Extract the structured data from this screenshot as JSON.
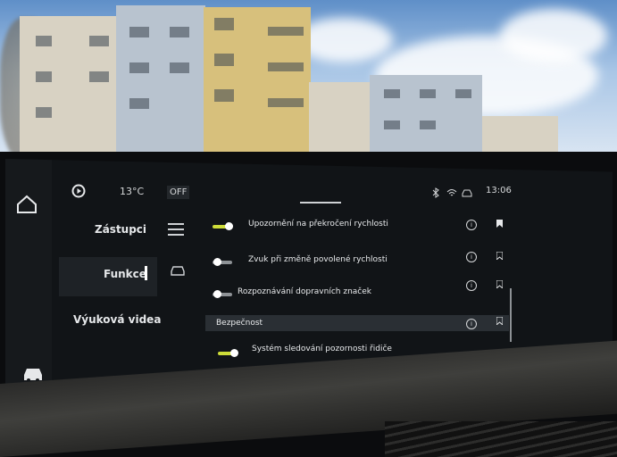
{
  "status_bar": {
    "temperature": "13°C",
    "ac_state": "OFF",
    "time": "13:06"
  },
  "sidebar": {
    "items": [
      {
        "label": "Zástupci"
      },
      {
        "label": "Funkce",
        "selected": true
      },
      {
        "label": "Výuková videa"
      }
    ]
  },
  "settings": {
    "rows": [
      {
        "label": "Upozornění na překročení rychlosti",
        "enabled": true,
        "bookmarked": true
      },
      {
        "label": "Zvuk při změně povolené rychlosti",
        "enabled": false,
        "bookmarked": false
      },
      {
        "label": "Rozpoznávání dopravních značek",
        "enabled": false,
        "bookmarked": false
      }
    ],
    "section_title": "Bezpečnost",
    "section_rows": [
      {
        "label": "Systém sledování pozornosti řidiče",
        "enabled": true,
        "bookmarked": false
      }
    ]
  },
  "colors": {
    "toggle_on": "#cddc39",
    "toggle_off": "#8e9296",
    "screen_bg": "#111417"
  },
  "icons": [
    "home-icon",
    "play-circle-icon",
    "menu-icon",
    "car-outline-icon",
    "car-icon",
    "bluetooth-icon",
    "wifi-icon",
    "info-icon",
    "bookmark-icon"
  ]
}
